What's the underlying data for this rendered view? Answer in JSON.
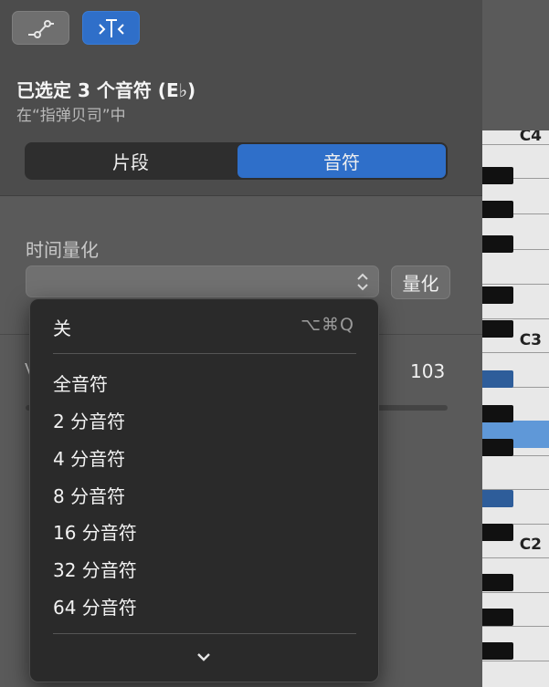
{
  "toolbar": {
    "automation_icon": "automation-curve-icon",
    "inspector_icon": "note-inspector-icon",
    "accent": "#2f6fc9"
  },
  "selection": {
    "title": "已选定 3 个音符 (E♭)",
    "subtitle": "在“指弹贝司”中"
  },
  "segmented": {
    "region_label": "片段",
    "notes_label": "音符",
    "active": "音符"
  },
  "time_quantize": {
    "label": "时间量化",
    "value": "",
    "button_label": "量化"
  },
  "velocity": {
    "label": "V",
    "value": "103"
  },
  "menu": {
    "off_label": "关",
    "off_shortcut": "⌥⌘Q",
    "items": [
      "全音符",
      "2 分音符",
      "4 分音符",
      "8 分音符",
      "16 分音符",
      "32 分音符",
      "64 分音符"
    ],
    "more_icon": "chevron-down-icon"
  },
  "piano": {
    "labels": [
      "C4",
      "C3",
      "C2"
    ],
    "selected_color": "#5f98d8"
  }
}
